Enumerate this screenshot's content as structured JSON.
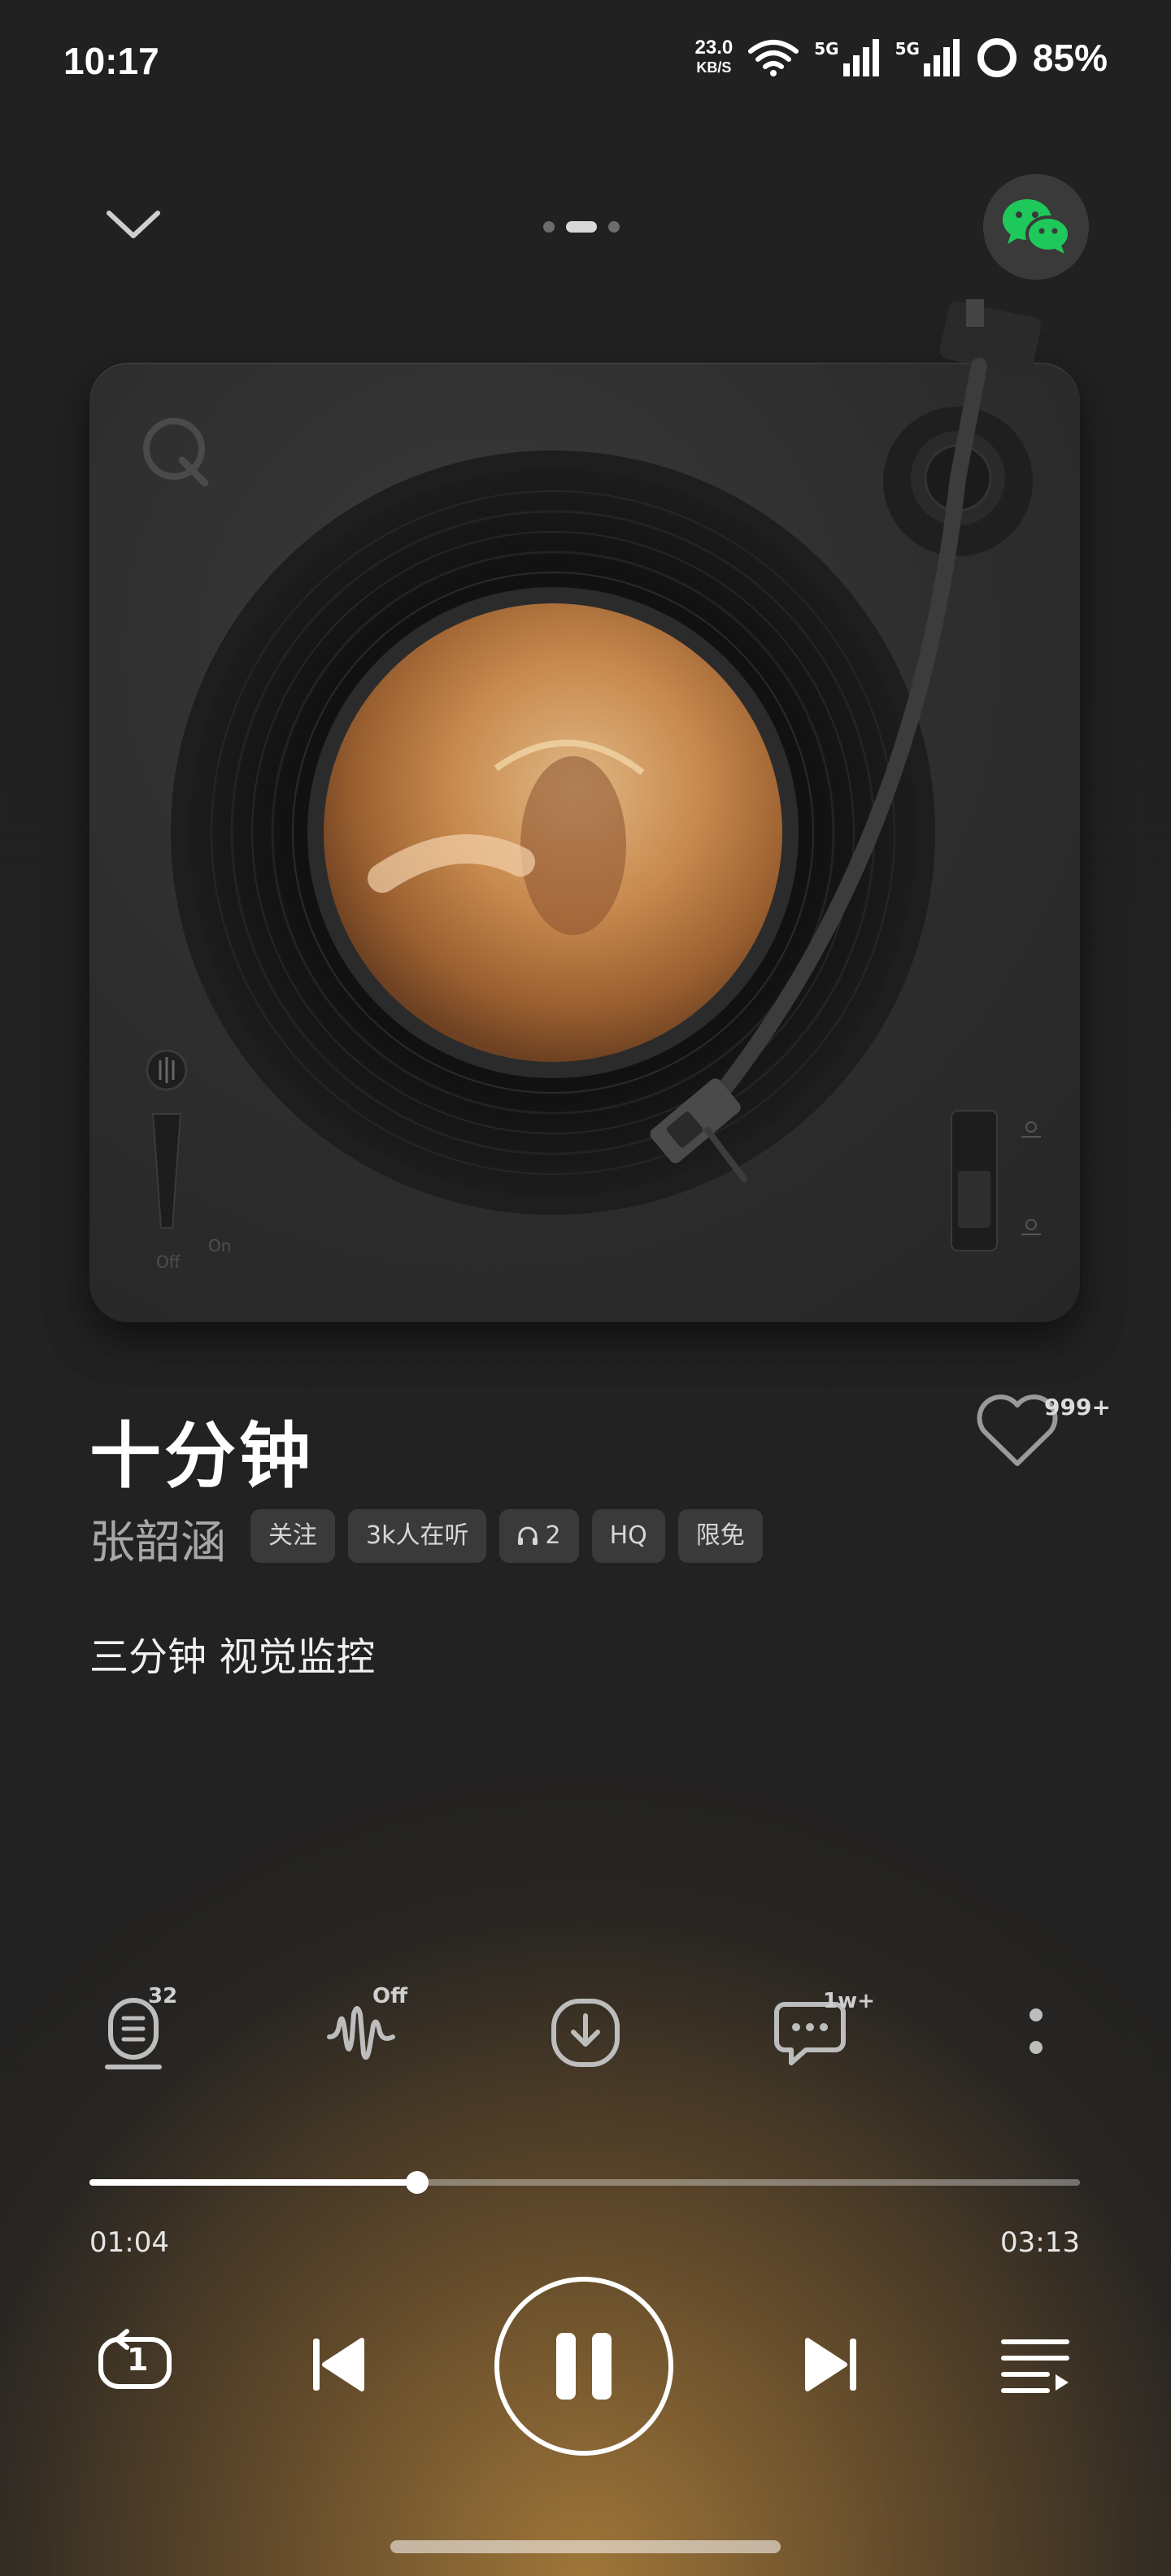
{
  "status_bar": {
    "time": "10:17",
    "net_speed_value": "23.0",
    "net_speed_unit": "KB/S",
    "signal_1_label": "5G",
    "signal_2_label": "5G",
    "battery": "85%"
  },
  "nav": {
    "collapse_icon": "chevron-down-icon",
    "pages": 3,
    "active_page": 2,
    "share_icon": "wechat-icon"
  },
  "turntable": {
    "logo_icon": "q-logo-icon",
    "switch_off_label": "Off",
    "switch_on_label": "On"
  },
  "song": {
    "title": "十分钟",
    "artist": "张韶涵",
    "tags": [
      "关注",
      "3k人在听",
      "2",
      "HQ",
      "限免"
    ],
    "listeners_icon": "headphones-icon",
    "like_count": "999+",
    "lyric": "三分钟 视觉监控"
  },
  "actions": {
    "lyrics_badge": "32",
    "effect_badge": "Off",
    "comment_badge": "1w+"
  },
  "progress": {
    "current": "01:04",
    "total": "03:13",
    "fraction": 0.331
  },
  "controls": {
    "repeat_badge": "1"
  },
  "colors": {
    "accent_gold": "#a67a3a",
    "wechat_green": "#1ec85a"
  }
}
